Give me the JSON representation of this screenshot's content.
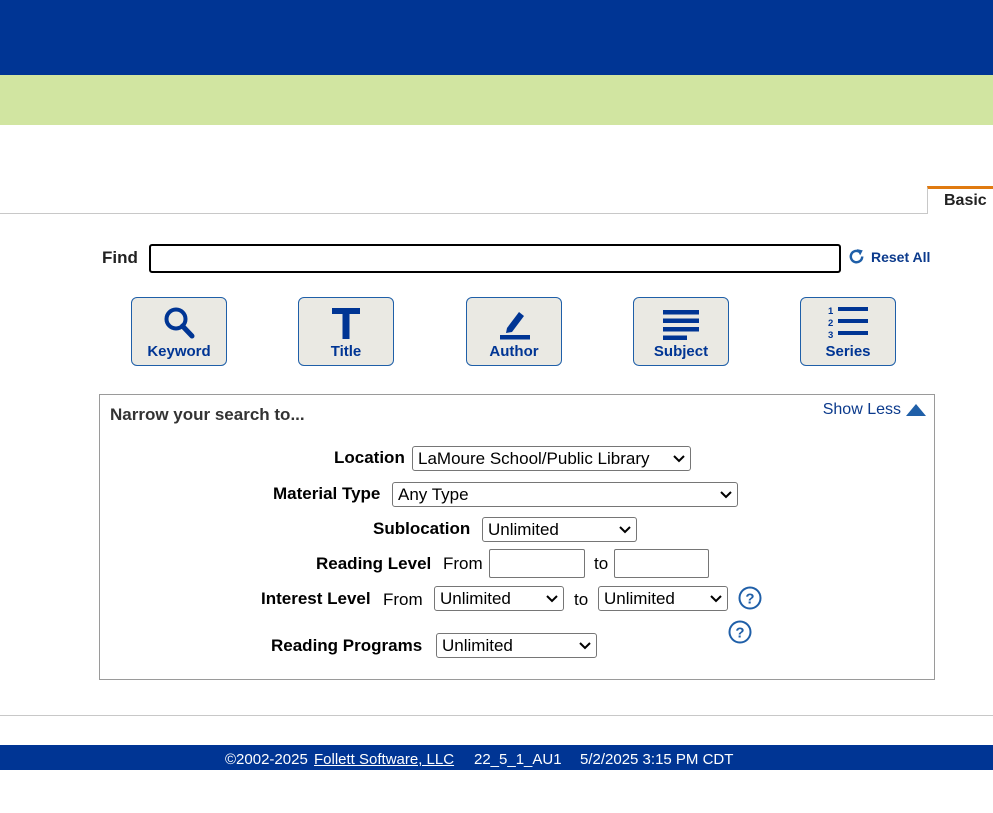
{
  "tabs": {
    "basic": "Basic"
  },
  "search": {
    "find_label": "Find",
    "value": "",
    "reset_label": "Reset All",
    "buttons": [
      {
        "label": "Keyword",
        "icon": "magnifier-icon"
      },
      {
        "label": "Title",
        "icon": "letter-t-icon"
      },
      {
        "label": "Author",
        "icon": "pencil-icon"
      },
      {
        "label": "Subject",
        "icon": "lines-icon"
      },
      {
        "label": "Series",
        "icon": "numbered-list-icon"
      }
    ]
  },
  "narrow": {
    "title": "Narrow your search to...",
    "show_less": "Show Less",
    "location": {
      "label": "Location",
      "value": "LaMoure School/Public Library"
    },
    "material_type": {
      "label": "Material Type",
      "value": "Any Type"
    },
    "sublocation": {
      "label": "Sublocation",
      "value": "Unlimited"
    },
    "reading_level": {
      "label": "Reading Level",
      "from": "From",
      "to": "to",
      "from_value": "",
      "to_value": ""
    },
    "interest_level": {
      "label": "Interest Level",
      "from": "From",
      "to": "to",
      "from_value": "Unlimited",
      "to_value": "Unlimited"
    },
    "reading_programs": {
      "label": "Reading Programs",
      "value": "Unlimited"
    }
  },
  "footer": {
    "copyright": "©2002-2025",
    "company_link": "Follett Software, LLC",
    "version": "22_5_1_AU1",
    "timestamp": "5/2/2025 3:15 PM CDT"
  },
  "colors": {
    "navy": "#003594",
    "green_band": "#d1e5a1",
    "tab_accent": "#e07a10",
    "link": "#0b3a8c"
  }
}
